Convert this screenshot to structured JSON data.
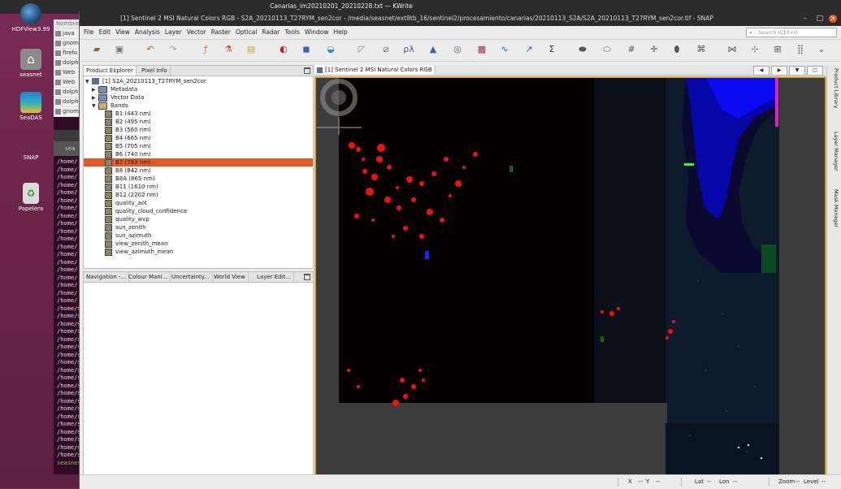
{
  "system_bar": {
    "title": "Canarias_im20210201_20210228.txt — KWrite"
  },
  "desktop_icons": [
    {
      "label": "HDFView3.99",
      "icon": "earth-icon"
    },
    {
      "label": "seasnet",
      "icon": "home-folder-icon"
    },
    {
      "label": "SeaDAS",
      "icon": "seadas-icon"
    },
    {
      "label": "SNAP",
      "icon": "snap-icon"
    },
    {
      "label": "Papelera",
      "icon": "trash-icon"
    }
  ],
  "background_window": {
    "header": "Nombre",
    "rows": [
      "java",
      "gnom",
      "firefo",
      "dolph",
      "Web",
      "Web",
      "dolph",
      "dolph",
      "gnom"
    ],
    "tab_label": "sea",
    "terminal_lines": [
      "/home/",
      "/home/",
      "/home/",
      "/home/",
      "/home/",
      "/home/",
      "/home/",
      "/home/",
      "/home/",
      "/home/",
      "/home/",
      "/home/",
      "/home/",
      "/home/",
      "/home/",
      "/home/",
      "/home/",
      "/home/",
      "/home/",
      "/home/s",
      "/home/s",
      "/home/s",
      "/home/s",
      "/home/s",
      "/home/s",
      "/home/s",
      "/home/s",
      "/home/s",
      "/home/s",
      "/home/s",
      "/home/s",
      "/home/s",
      "/home/s",
      "/home/s",
      "/home/s",
      "/home/s",
      "/home/s",
      "/home/s",
      "/home/s"
    ],
    "prompt": "seasnet"
  },
  "snap": {
    "window_title": "[1] Sentinel 2 MSI Natural Colors RGB - S2A_20210113_T27RYM_sen2cor - /media/seasnet/ext8tb_16/sentinel2/procesamiento/canarias/20210113_S2A/S2A_20210113_T27RYM_sen2cor.tif - SNAP",
    "menu": [
      "File",
      "Edit",
      "View",
      "Analysis",
      "Layer",
      "Vector",
      "Raster",
      "Optical",
      "Radar",
      "Tools",
      "Window",
      "Help"
    ],
    "search_placeholder": "Search (Ctrl+I)",
    "explorer_tabs": [
      "Product Explorer",
      "Pixel Info"
    ],
    "product": "[1] S2A_20210113_T27RYM_sen2cor",
    "folders": [
      "Metadata",
      "Vector Data",
      "Bands"
    ],
    "bands": [
      "B1 (443 nm)",
      "B2 (495 nm)",
      "B3 (560 nm)",
      "B4 (665 nm)",
      "B5 (705 nm)",
      "B6 (740 nm)",
      "B7 (783 nm)",
      "B8 (842 nm)",
      "B8A (865 nm)",
      "B11 (1610 nm)",
      "B12 (2202 nm)",
      "quality_aot",
      "quality_cloud_confidence",
      "quality_wvp",
      "sun_zenith",
      "sun_azimuth",
      "view_zenith_mean",
      "view_azimuth_mean"
    ],
    "selected_band_index": 6,
    "nav_tabs": [
      "Navigation -...",
      "Colour Mani...",
      "Uncertainty...",
      "World View",
      "Layer Edit..."
    ],
    "view_tab": "[1] Sentinel 2 MSI Natural Colors RGB",
    "right_strip": [
      "Product Library",
      "Layer Manager",
      "Mask Manager"
    ],
    "status": {
      "x": "X",
      "x_val": "--",
      "y": "Y",
      "y_val": "--",
      "lat": "Lat",
      "lat_val": "--",
      "lon": "Lon",
      "lon_val": "--",
      "zoom": "Zoom",
      "zoom_val": "--",
      "level": "Level",
      "level_val": "--"
    },
    "colors": {
      "selection": "#e05a2b",
      "view_border": "#d4a72c",
      "title_bg": "#2b2b2b"
    }
  }
}
